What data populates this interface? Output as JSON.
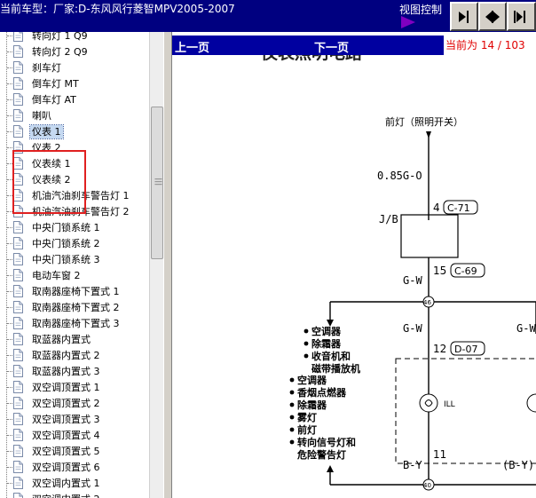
{
  "header": {
    "title": "当前车型：厂家:D-东风风行菱智MPV2005-2007",
    "view_control_label": "视图控制",
    "buttons": [
      {
        "name": "show-panel-button",
        "icon": "panel-arrow-icon"
      },
      {
        "name": "fit-width-button",
        "icon": "expand-arrows-icon"
      },
      {
        "name": "shrink-button",
        "icon": "collapse-arrows-icon"
      }
    ]
  },
  "sidebar": {
    "items": [
      {
        "label": "转向灯 1 Q9"
      },
      {
        "label": "转向灯 2 Q9"
      },
      {
        "label": "刹车灯"
      },
      {
        "label": "倒车灯 MT"
      },
      {
        "label": "倒车灯 AT"
      },
      {
        "label": "喇叭"
      },
      {
        "label": "仪表 1",
        "selected": true
      },
      {
        "label": "仪表 2"
      },
      {
        "label": "仪表续 1"
      },
      {
        "label": "仪表续 2"
      },
      {
        "label": "机油汽油刹车警告灯 1"
      },
      {
        "label": "机油汽油刹车警告灯 2"
      },
      {
        "label": "中央门锁系统 1"
      },
      {
        "label": "中央门锁系统 2"
      },
      {
        "label": "中央门锁系统 3"
      },
      {
        "label": "电动车窗 2"
      },
      {
        "label": "取南器座椅下置式 1"
      },
      {
        "label": "取南器座椅下置式 2"
      },
      {
        "label": "取南器座椅下置式 3"
      },
      {
        "label": "取蓝器内置式"
      },
      {
        "label": "取蓝器内置式 2"
      },
      {
        "label": "取蓝器内置式 3"
      },
      {
        "label": "双空调顶置式 1"
      },
      {
        "label": "双空调顶置式 2"
      },
      {
        "label": "双空调顶置式 3"
      },
      {
        "label": "双空调顶置式 4"
      },
      {
        "label": "双空调顶置式 5"
      },
      {
        "label": "双空调顶置式 6"
      },
      {
        "label": "双空调内置式 1"
      },
      {
        "label": "双空调内置式 2"
      }
    ]
  },
  "nav": {
    "prev_label": "上一页",
    "next_label": "下一页",
    "page_indicator": "当前为 14 / 103"
  },
  "diagram": {
    "title": "仪表照明电路",
    "headlight_label": "前灯（照明开关）",
    "wire_085": "0.85G-O",
    "jb_label": "J/B",
    "pin_4": "4",
    "conn_c71": "C-71",
    "pin_15": "15",
    "conn_c69": "C-69",
    "wire_gw_1": "G-W",
    "node_46": "46",
    "wire_gw_2": "G-W",
    "wire_gw_3": "G-W",
    "pin_12": "12",
    "conn_d07": "D-07",
    "ill_label": "ILL",
    "pin_11": "11",
    "wire_by": "B-Y",
    "wire_by2": "(B-Y)",
    "node_40": "40",
    "list_a": [
      "空调器",
      "除霜器",
      "收音机和",
      "磁带播放机"
    ],
    "list_b": [
      "空调器",
      "香烟点燃器",
      "除霜器",
      "雾灯",
      "前灯",
      "转向信号灯和",
      "危险警告灯"
    ]
  }
}
